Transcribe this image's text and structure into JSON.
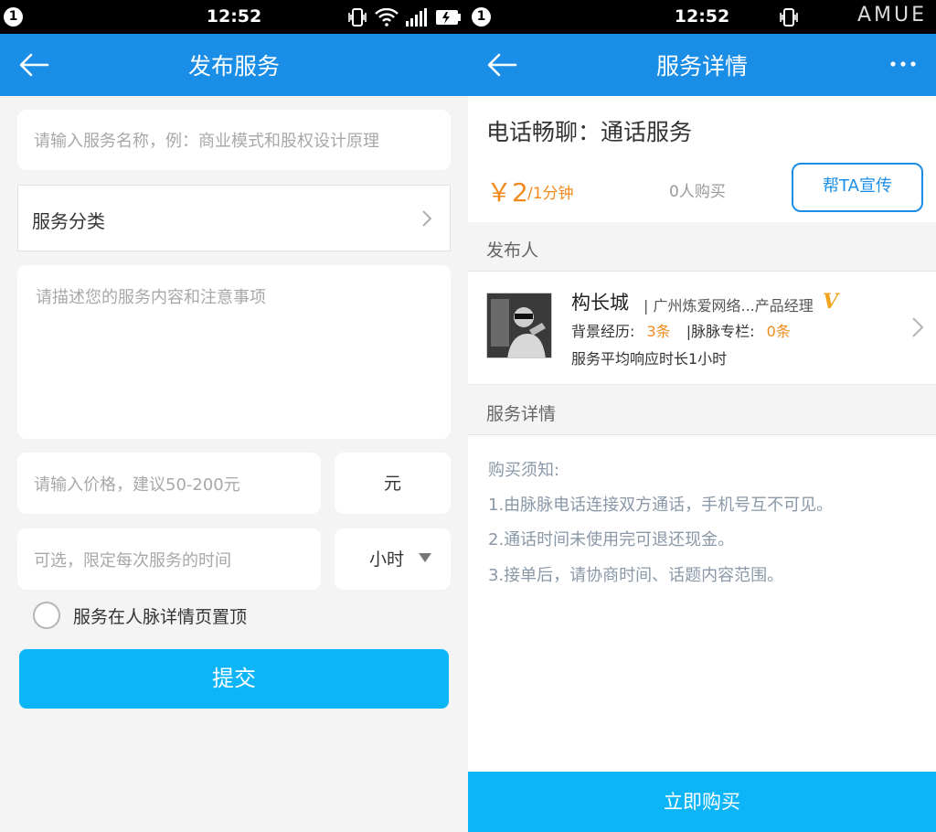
{
  "status": {
    "badge": "1",
    "time": "12:52",
    "watermark": "AMUE"
  },
  "left": {
    "nav": {
      "title": "发布服务"
    },
    "form": {
      "name_placeholder": "请输入服务名称，例：商业模式和股权设计原理",
      "category_label": "服务分类",
      "desc_placeholder": "请描述您的服务内容和注意事项",
      "price_placeholder": "请输入价格，建议50-200元",
      "price_unit": "元",
      "time_placeholder": "可选，限定每次服务的时间",
      "time_unit": "小时",
      "pin_label": "服务在人脉详情页置顶",
      "submit_label": "提交"
    }
  },
  "right": {
    "nav": {
      "title": "服务详情"
    },
    "service": {
      "title": "电话畅聊：通话服务",
      "price": "￥2",
      "price_unit": "/1分钟",
      "buyers": "0人购买",
      "promote_label": "帮TA宣传"
    },
    "publisher_header": "发布人",
    "publisher": {
      "name": "构长城",
      "company": "| 广州炼爱网络...产品经理",
      "verified": "V",
      "bg_label": "背景经历:",
      "bg_count": "3条",
      "column_label": "|脉脉专栏:",
      "column_count": "0条",
      "response": "服务平均响应时长1小时"
    },
    "detail_header": "服务详情",
    "detail": {
      "heading": "购买须知:",
      "items": [
        "1.由脉脉电话连接双方通话，手机号互不可见。",
        "2.通话时间未使用完可退还现金。",
        "3.接单后，请协商时间、话题内容范围。"
      ]
    },
    "buy_label": "立即购买"
  },
  "colors": {
    "nav_blue": "#1a8ee6",
    "button_cyan": "#0bb5f8",
    "accent_orange": "#f28a1d",
    "verified_gold": "#f2a31a"
  },
  "icons": [
    "back-arrow-icon",
    "more-dots-icon",
    "chevron-right-icon",
    "dropdown-triangle-icon",
    "vibrate-icon",
    "wifi-icon",
    "signal-icon",
    "battery-icon"
  ]
}
